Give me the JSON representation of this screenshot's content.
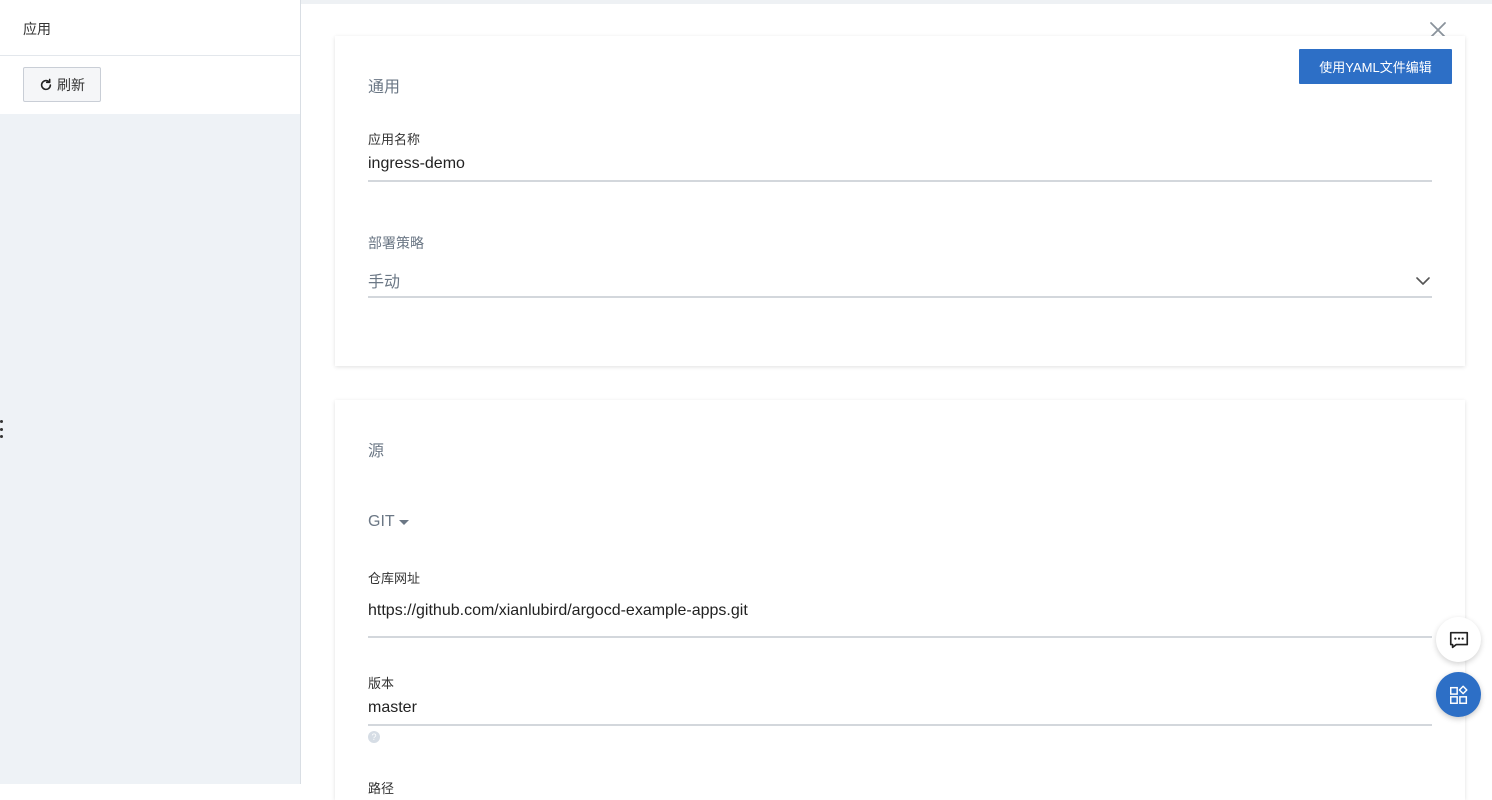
{
  "left_panel": {
    "title": "应用",
    "refresh_label": "刷新"
  },
  "header": {
    "yaml_button_label": "使用YAML文件编辑"
  },
  "general": {
    "section_title": "通用",
    "app_name_label": "应用名称",
    "app_name_value": "ingress-demo",
    "sync_policy_label": "部署策略",
    "sync_policy_value": "手动"
  },
  "source": {
    "section_title": "源",
    "repo_type": "GIT",
    "repo_url_label": "仓库网址",
    "repo_url_value": "https://github.com/xianlubird/argocd-example-apps.git",
    "revision_label": "版本",
    "revision_value": "master",
    "help_glyph": "?",
    "path_label": "路径"
  },
  "colors": {
    "accent": "#2d6fc6",
    "sidebar_bg": "#eef2f6"
  },
  "icons": [
    "refresh-icon",
    "close-icon",
    "chevron-down-icon",
    "caret-down-icon",
    "help-icon",
    "chat-icon",
    "apps-icon"
  ]
}
